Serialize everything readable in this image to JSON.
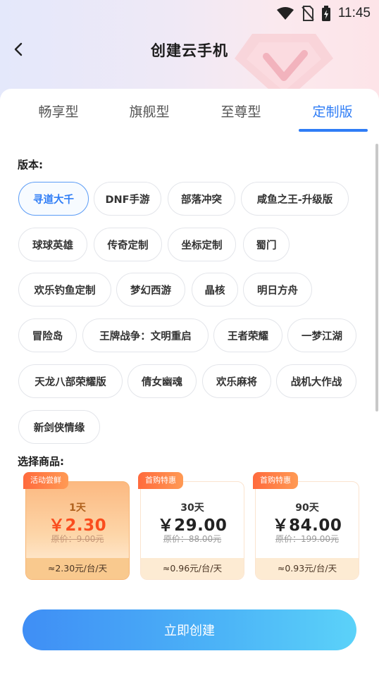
{
  "status_bar": {
    "time": "11:45"
  },
  "header": {
    "title": "创建云手机"
  },
  "tabs": [
    {
      "label": "畅享型"
    },
    {
      "label": "旗舰型"
    },
    {
      "label": "至尊型"
    },
    {
      "label": "定制版",
      "active": true
    }
  ],
  "version_label": "版本:",
  "versions": [
    "寻道大千",
    "DNF手游",
    "部落冲突",
    "咸鱼之王-升级版",
    "球球英雄",
    "传奇定制",
    "坐标定制",
    "蜀门",
    "欢乐钓鱼定制",
    "梦幻西游",
    "晶核",
    "明日方舟",
    "冒险岛",
    "王牌战争：文明重启",
    "王者荣耀",
    "一梦江湖",
    "天龙八部荣耀版",
    "倩女幽魂",
    "欢乐麻将",
    "战机大作战",
    "新剑侠情缘"
  ],
  "selected_version": "寻道大千",
  "products_label": "选择商品:",
  "products": [
    {
      "badge": "活动尝鲜",
      "days": "1天",
      "price": "￥2.30",
      "original": "原价：9.00元",
      "per_day": "≈2.30元/台/天",
      "selected": true
    },
    {
      "badge": "首购特惠",
      "days": "30天",
      "price": "￥29.00",
      "original": "原价：88.00元",
      "per_day": "≈0.96元/台/天"
    },
    {
      "badge": "首购特惠",
      "days": "90天",
      "price": "￥84.00",
      "original": "原价：199.00元",
      "per_day": "≈0.93元/台/天"
    }
  ],
  "create_button": "立即创建",
  "colors": {
    "accent": "#2f7df6",
    "price_highlight": "#fa4d1e",
    "badge": "#ff6a3d"
  }
}
